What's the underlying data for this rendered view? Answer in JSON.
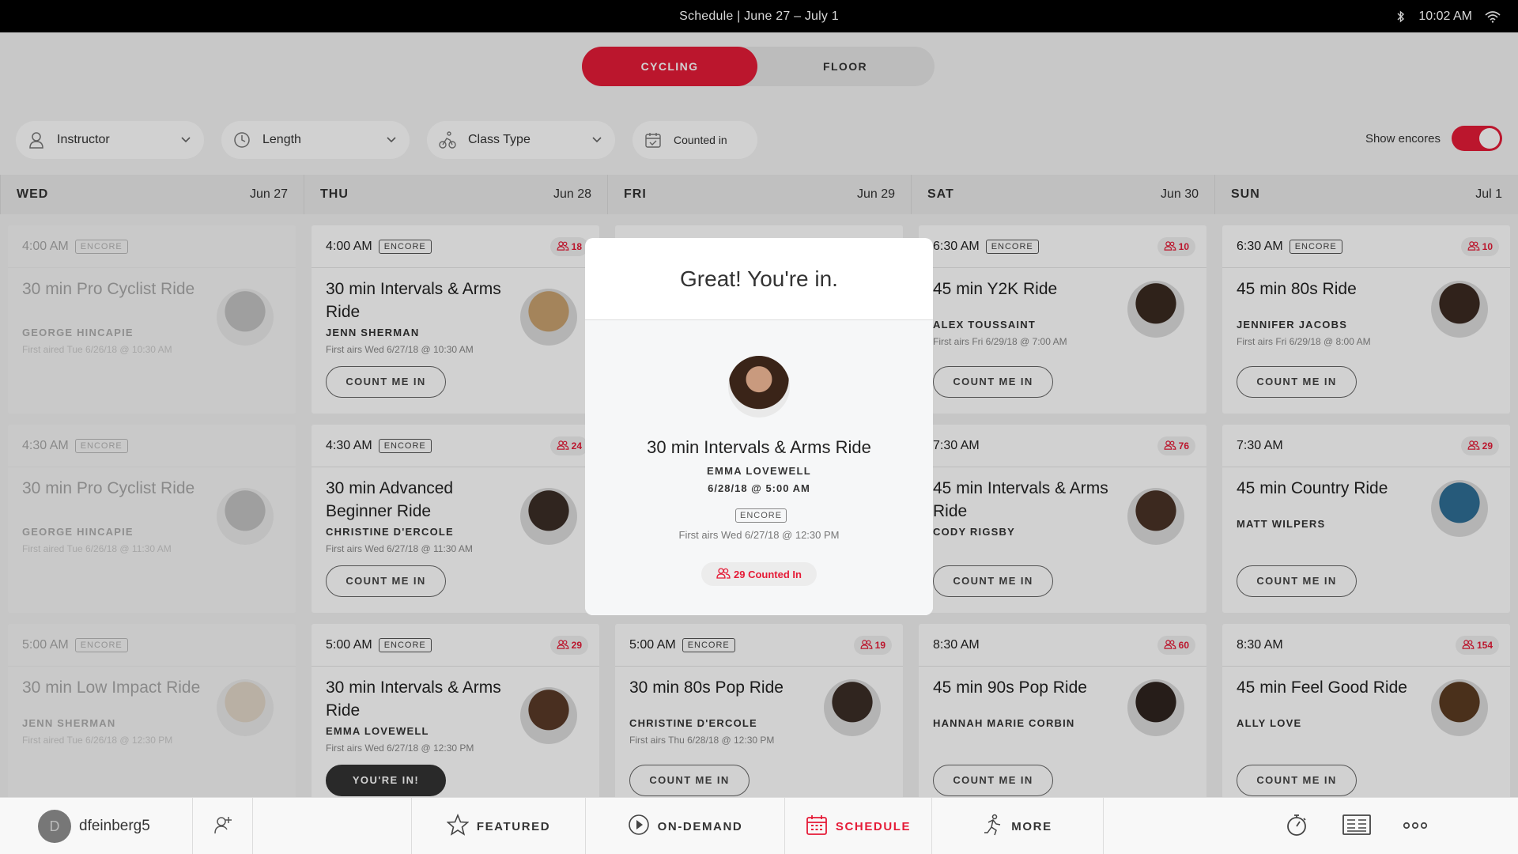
{
  "status_bar": {
    "title": "Schedule | June 27 – July 1",
    "time": "10:02 AM"
  },
  "segments": {
    "active": "CYCLING",
    "inactive": "FLOOR"
  },
  "filters": {
    "instructor": "Instructor",
    "length": "Length",
    "class_type": "Class Type",
    "counted_in": "Counted in",
    "show_encores_label": "Show encores",
    "show_encores_on": true
  },
  "colors": {
    "accent": "#e51b37"
  },
  "days": [
    {
      "name": "WED",
      "date": "Jun 27",
      "faded": true,
      "classes": [
        {
          "time": "4:00 AM",
          "encore": "ENCORE",
          "count": "",
          "title": "30 min Pro Cyclist Ride",
          "instructor": "GEORGE HINCAPIE",
          "airs": "First aired Tue 6/26/18 @ 10:30 AM",
          "button": "",
          "avatar": "#6d6d6d"
        },
        {
          "time": "4:30 AM",
          "encore": "ENCORE",
          "count": "",
          "title": "30 min Pro Cyclist Ride",
          "instructor": "GEORGE HINCAPIE",
          "airs": "First aired Tue 6/26/18 @ 11:30 AM",
          "button": "",
          "avatar": "#6d6d6d"
        },
        {
          "time": "5:00 AM",
          "encore": "ENCORE",
          "count": "",
          "title": "30 min Low Impact Ride",
          "instructor": "JENN SHERMAN",
          "airs": "First aired Tue 6/26/18 @ 12:30 PM",
          "button": "",
          "avatar": "#c7a77c"
        }
      ]
    },
    {
      "name": "THU",
      "date": "Jun 28",
      "faded": false,
      "classes": [
        {
          "time": "4:00 AM",
          "encore": "ENCORE",
          "count": "18",
          "title": "30 min Intervals & Arms Ride",
          "instructor": "JENN SHERMAN",
          "airs": "First airs Wed 6/27/18 @ 10:30 AM",
          "button": "COUNT ME IN",
          "avatar": "#c9a26f"
        },
        {
          "time": "4:30 AM",
          "encore": "ENCORE",
          "count": "24",
          "title": "30 min Advanced Beginner Ride",
          "instructor": "CHRISTINE D'ERCOLE",
          "airs": "First airs Wed 6/27/18 @ 11:30 AM",
          "button": "COUNT ME IN",
          "avatar": "#3b2e27"
        },
        {
          "time": "5:00 AM",
          "encore": "ENCORE",
          "count": "29",
          "title": "30 min Intervals & Arms Ride",
          "instructor": "EMMA LOVEWELL",
          "airs": "First airs Wed 6/27/18 @ 12:30 PM",
          "button": "YOU'RE IN!",
          "avatar": "#5a3a28"
        }
      ]
    },
    {
      "name": "FRI",
      "date": "Jun 29",
      "faded": false,
      "classes": [
        {
          "time": "5:00 AM",
          "encore": "ENCORE",
          "count": "19",
          "title": "30 min 80s Pop Ride",
          "instructor": "CHRISTINE D'ERCOLE",
          "airs": "First airs Thu 6/28/18 @ 12:30 PM",
          "button": "COUNT ME IN",
          "avatar": "#3b2e27"
        }
      ]
    },
    {
      "name": "SAT",
      "date": "Jun 30",
      "faded": false,
      "classes": [
        {
          "time": "6:30 AM",
          "encore": "ENCORE",
          "count": "10",
          "title": "45 min Y2K Ride",
          "instructor": "ALEX TOUSSAINT",
          "airs": "First airs Fri 6/29/18 @ 7:00 AM",
          "button": "COUNT ME IN",
          "avatar": "#3a2a20"
        },
        {
          "time": "7:30 AM",
          "encore": "",
          "count": "76",
          "title": "45 min Intervals & Arms Ride",
          "instructor": "CODY RIGSBY",
          "airs": "",
          "button": "COUNT ME IN",
          "avatar": "#4a3326"
        },
        {
          "time": "8:30 AM",
          "encore": "",
          "count": "60",
          "title": "45 min 90s Pop Ride",
          "instructor": "HANNAH MARIE CORBIN",
          "airs": "",
          "button": "COUNT ME IN",
          "avatar": "#2f241f"
        }
      ]
    },
    {
      "name": "SUN",
      "date": "Jul 1",
      "faded": false,
      "classes": [
        {
          "time": "6:30 AM",
          "encore": "ENCORE",
          "count": "10",
          "title": "45 min 80s Ride",
          "instructor": "JENNIFER JACOBS",
          "airs": "First airs Fri 6/29/18 @ 8:00 AM",
          "button": "COUNT ME IN",
          "avatar": "#3b2a22"
        },
        {
          "time": "7:30 AM",
          "encore": "",
          "count": "29",
          "title": "45 min Country Ride",
          "instructor": "MATT WILPERS",
          "airs": "",
          "button": "COUNT ME IN",
          "avatar": "#2f6e95"
        },
        {
          "time": "8:30 AM",
          "encore": "",
          "count": "154",
          "title": "45 min Feel Good Ride",
          "instructor": "ALLY LOVE",
          "airs": "",
          "button": "COUNT ME IN",
          "avatar": "#5b3b22"
        }
      ]
    }
  ],
  "modal": {
    "heading": "Great! You're in.",
    "class_title": "30 min Intervals & Arms Ride",
    "instructor": "EMMA LOVEWELL",
    "datetime": "6/28/18 @ 5:00 AM",
    "encore": "ENCORE",
    "airs": "First airs Wed 6/27/18 @ 12:30 PM",
    "counted": "29 Counted In"
  },
  "nav": {
    "username": "dfeinberg5",
    "avatar_initial": "D",
    "featured": "FEATURED",
    "on_demand": "ON-DEMAND",
    "schedule": "SCHEDULE",
    "more": "MORE"
  }
}
